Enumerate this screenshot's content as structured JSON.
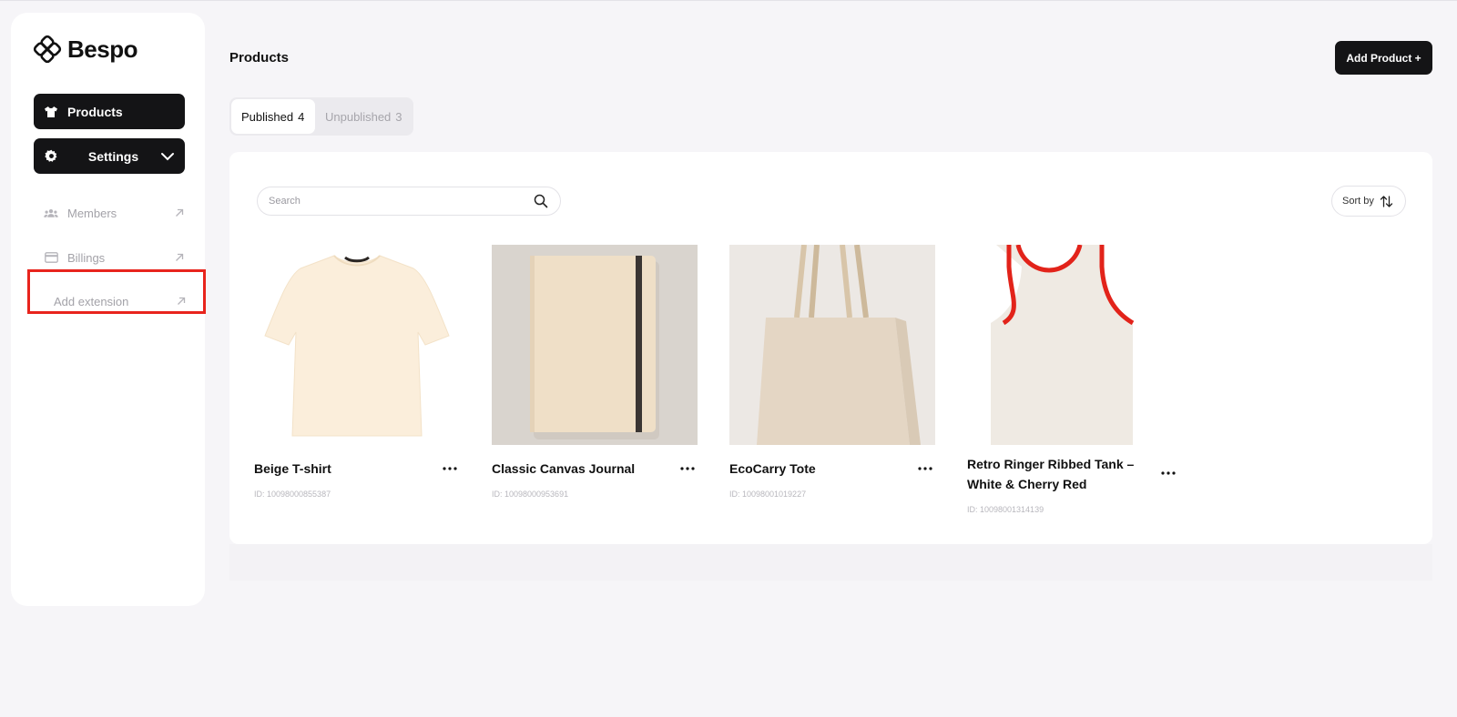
{
  "brand": {
    "name": "Bespo",
    "logo_icon": "bespo-logo-icon"
  },
  "sidebar": {
    "products_label": "Products",
    "settings_label": "Settings",
    "sub_items": [
      {
        "label": "Members",
        "icon": "members-icon"
      },
      {
        "label": "Billings",
        "icon": "card-icon"
      },
      {
        "label": "Add extension",
        "icon": ""
      }
    ],
    "highlight_color": "#e8241d"
  },
  "header": {
    "title": "Products",
    "add_button": "Add Product +"
  },
  "tabs": [
    {
      "label": "Published",
      "count": "4",
      "active": true
    },
    {
      "label": "Unpublished",
      "count": "3",
      "active": false
    }
  ],
  "toolbar": {
    "search_placeholder": "Search",
    "sort_label": "Sort by"
  },
  "products": [
    {
      "title": "Beige T-shirt",
      "id": "ID: 10098000855387",
      "image": "beige-tshirt"
    },
    {
      "title": "Classic Canvas Journal",
      "id": "ID: 10098000953691",
      "image": "canvas-journal"
    },
    {
      "title": "EcoCarry Tote",
      "id": "ID: 10098001019227",
      "image": "tote-bag"
    },
    {
      "title": "Retro Ringer Ribbed Tank – White & Cherry Red",
      "id": "ID: 10098001314139",
      "image": "ringer-tank"
    }
  ],
  "colors": {
    "accent": "#141416",
    "background": "#f6f5f8"
  }
}
